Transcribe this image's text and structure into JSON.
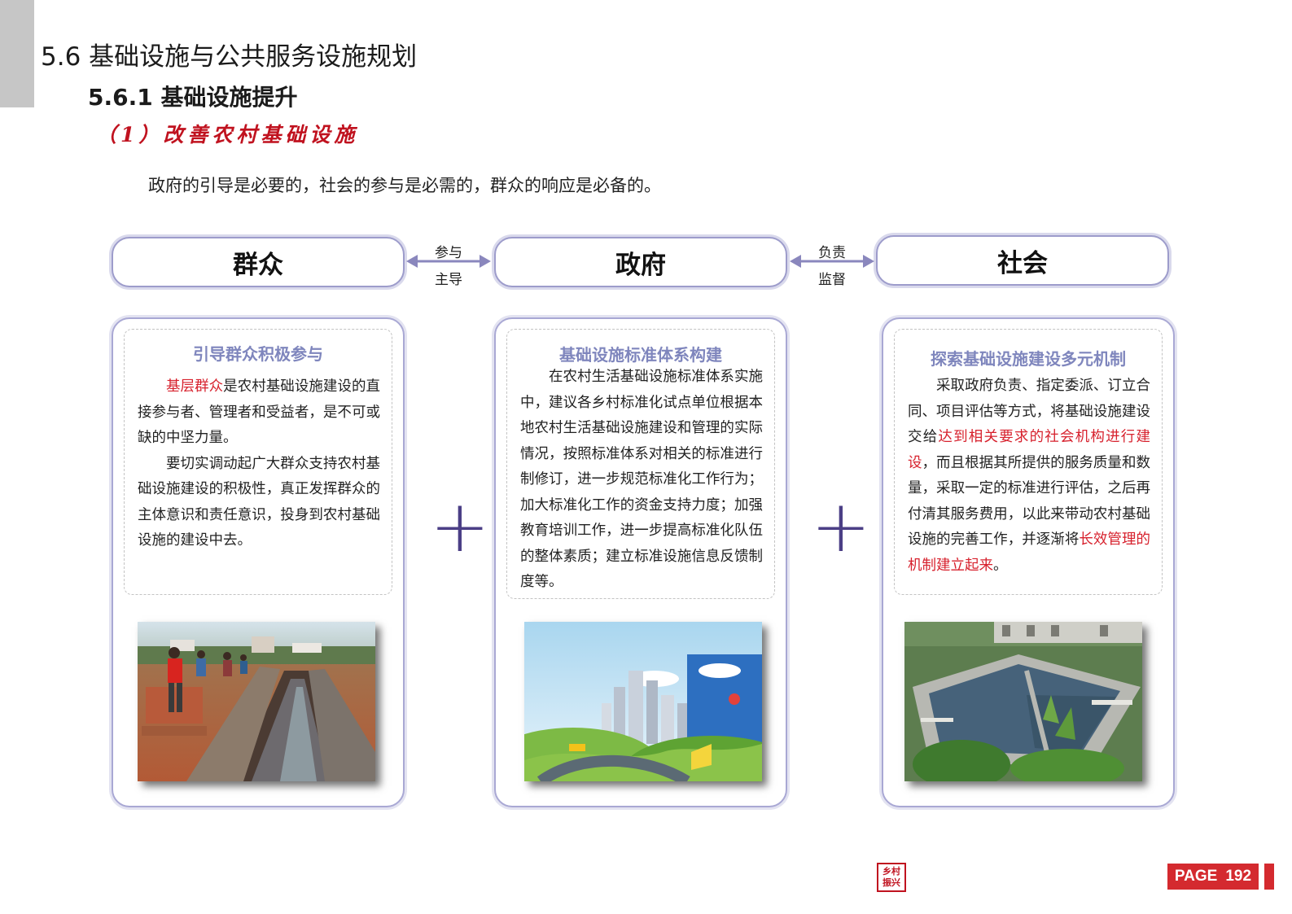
{
  "headings": {
    "section": "5.6 基础设施与公共服务设施规划",
    "subsection": "5.6.1 基础设施提升",
    "item": "（1）改善农村基础设施"
  },
  "intro": "政府的引导是必要的，社会的参与是必需的，群众的响应是必备的。",
  "roles": {
    "masses": "群众",
    "government": "政府",
    "society": "社会"
  },
  "arrows": {
    "left": {
      "top": "参与",
      "bottom": "主导"
    },
    "right": {
      "top": "负责",
      "bottom": "监督"
    }
  },
  "plus_sign": "+",
  "cards": {
    "masses": {
      "title": "引导群众积极参与",
      "p1_red": "基层群众",
      "p1_rest": "是农村基础设施建设的直接参与者、管理者和受益者，是不可或缺的中坚力量。",
      "p2": "要切实调动起广大群众支持农村基础设施建设的积极性，真正发挥群众的主体意识和责任意识，投身到农村基础设施的建设中去。"
    },
    "government": {
      "title": "基础设施标准体系构建",
      "p1": "在农村生活基础设施标准体系实施中，建议各乡村标准化试点单位根据本地农村生活基础设施建设和管理的实际情况，按照标准体系对相关的标准进行制修订，进一步规范标准化工作行为；加大标准化工作的资金支持力度；加强教育培训工作，进一步提高标准化队伍的整体素质；建立标准设施信息反馈制度等。"
    },
    "society": {
      "title": "探索基础设施建设多元机制",
      "p1_a": "采取政府负责、指定委派、订立合同、项目评估等方式，将基础设施建设交给",
      "p1_red1": "达到相关要求的社会机构进行建设",
      "p1_b": "，而且根据其所提供的服务质量和数量，采取一定的标准进行评估，之后再付清其服务费用，以此来带动农村基础设施的完善工作，并逐渐将",
      "p1_red2": "长效管理的机制建立起来",
      "p1_c": "。"
    }
  },
  "footer": {
    "logo_text": "乡村振兴",
    "page_label": "PAGE",
    "page_number": "192"
  },
  "colors": {
    "accent_red": "#d42a2f",
    "heading_red": "#c0121f",
    "card_title": "#7f86bd",
    "border": "#a9a8d4",
    "plus": "#4b3f86"
  }
}
